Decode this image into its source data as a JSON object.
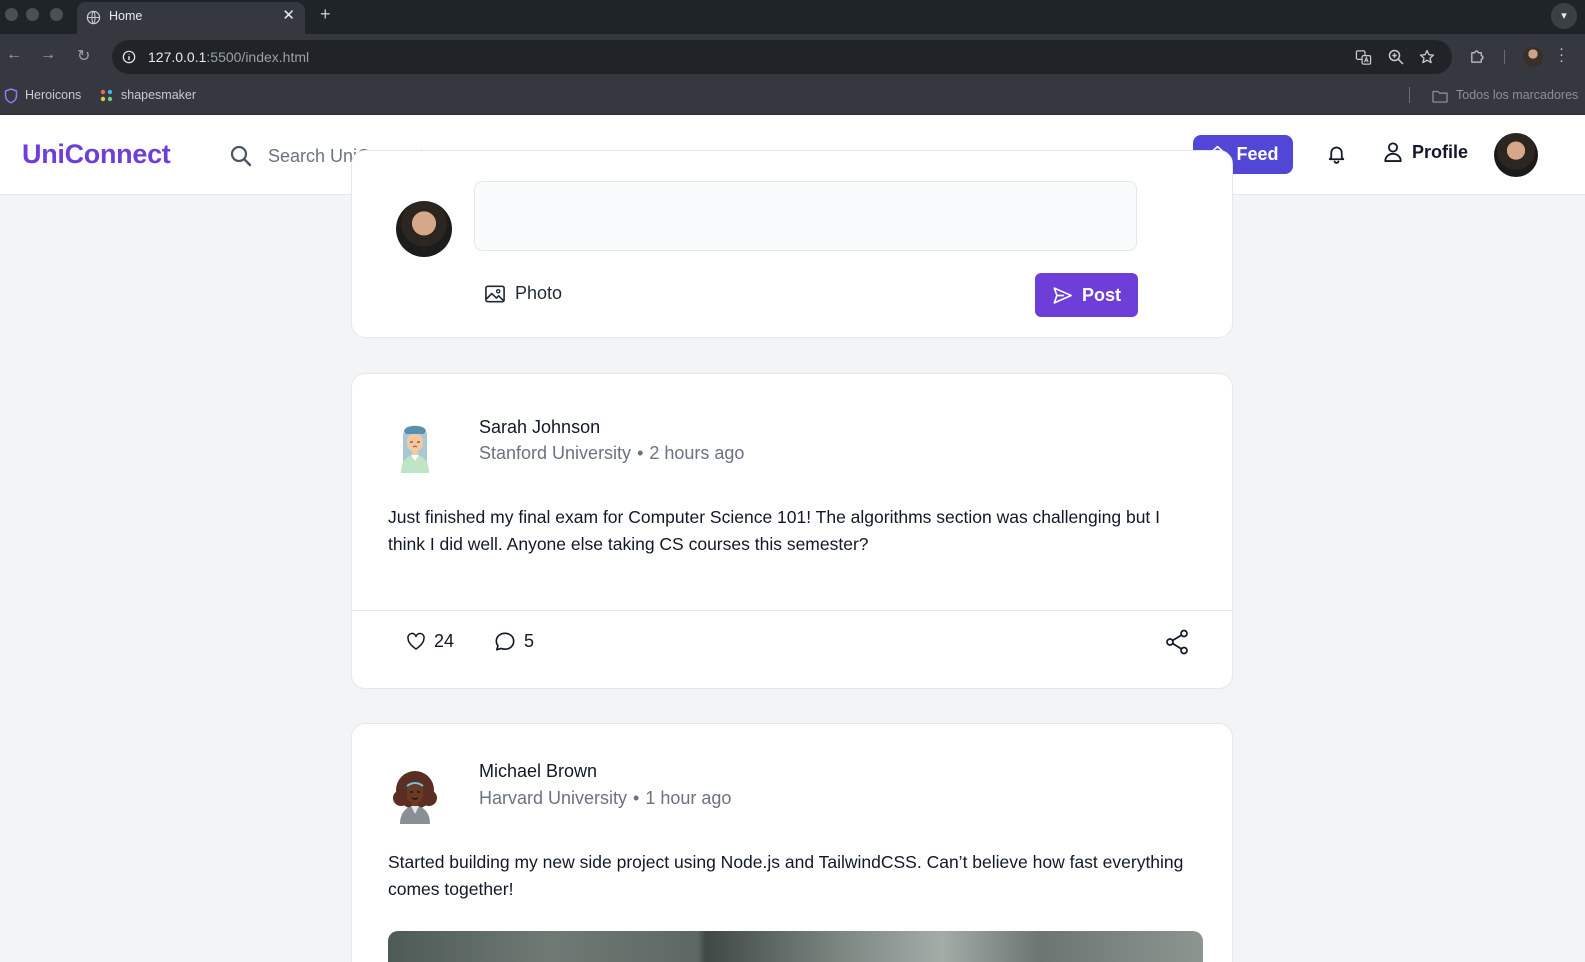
{
  "browser": {
    "tab_title": "Home",
    "url_host": "127.0.0.1",
    "url_rest": ":5500/index.html",
    "bookmarks": [
      "Heroicons",
      "shapesmaker"
    ],
    "all_bookmarks": "Todos los marcadores"
  },
  "app": {
    "logo": "UniConnect",
    "search_placeholder": "Search UniConnect...",
    "nav_feed": "Feed",
    "nav_profile": "Profile",
    "accent_color": "#6d3fd8",
    "feed_button_color": "#5146d6"
  },
  "composer": {
    "photo_label": "Photo",
    "post_label": "Post"
  },
  "posts": [
    {
      "author": "Sarah Johnson",
      "university": "Stanford University",
      "time": "2 hours ago",
      "separator": "•",
      "body": "Just finished my final exam for Computer Science 101! The algorithms section was challenging but I think I did well. Anyone else taking CS courses this semester?",
      "likes": "24",
      "comments": "5"
    },
    {
      "author": "Michael Brown",
      "university": "Harvard University",
      "time": "1 hour ago",
      "separator": "•",
      "body": "Started building my new side project using Node.js and TailwindCSS. Can’t believe how fast everything comes together!"
    }
  ]
}
